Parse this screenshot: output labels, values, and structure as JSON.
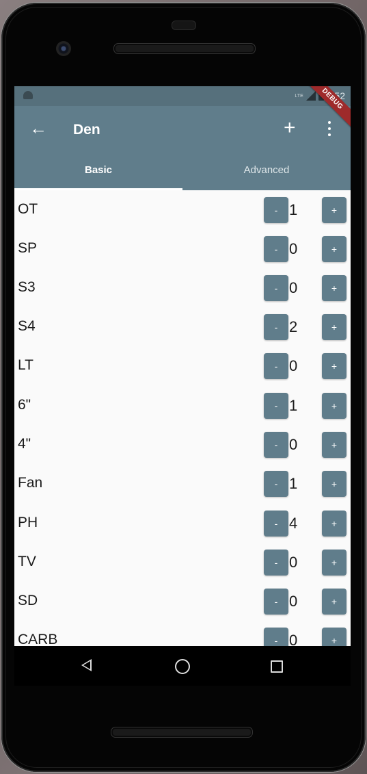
{
  "status": {
    "time": "1:52",
    "network": "LTE"
  },
  "appbar": {
    "title": "Den",
    "debug_banner": "DEBUG"
  },
  "tabs": [
    {
      "label": "Basic"
    },
    {
      "label": "Advanced"
    }
  ],
  "stepper": {
    "minus_label": "-",
    "plus_label": "+"
  },
  "items": [
    {
      "label": "OT",
      "count": "1"
    },
    {
      "label": "SP",
      "count": "0"
    },
    {
      "label": "S3",
      "count": "0"
    },
    {
      "label": "S4",
      "count": "2"
    },
    {
      "label": "LT",
      "count": "0"
    },
    {
      "label": "6\"",
      "count": "1"
    },
    {
      "label": "4\"",
      "count": "0"
    },
    {
      "label": "Fan",
      "count": "1"
    },
    {
      "label": "PH",
      "count": "4"
    },
    {
      "label": "TV",
      "count": "0"
    },
    {
      "label": "SD",
      "count": "0"
    },
    {
      "label": "CARB",
      "count": "0"
    }
  ],
  "colors": {
    "primary": "#607d8b",
    "status_bar": "#56707c",
    "debug": "#9e2a2b"
  }
}
